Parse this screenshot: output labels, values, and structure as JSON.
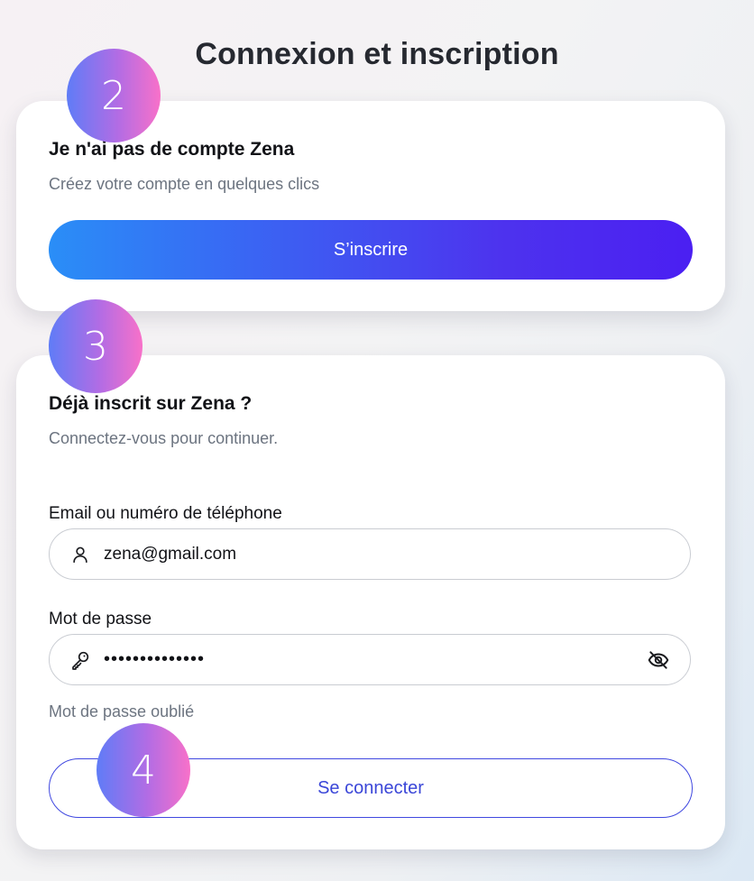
{
  "page": {
    "title": "Connexion et inscription"
  },
  "steps": {
    "signup": "2",
    "login": "3",
    "submit": "4"
  },
  "signup_card": {
    "title": "Je n'ai pas de compte Zena",
    "subtitle": "Créez votre compte en quelques clics",
    "button_label": "S’inscrire"
  },
  "login_card": {
    "title": "Déjà inscrit sur Zena ?",
    "subtitle": "Connectez-vous pour continuer.",
    "email_label": "Email ou numéro de téléphone",
    "email_value": "zena@gmail.com",
    "password_label": "Mot de passe",
    "password_value": "••••••••••••••",
    "forgot_label": "Mot de passe oublié",
    "submit_label": "Se connecter"
  },
  "icons": {
    "email_field": "user-icon",
    "password_field": "key-icon",
    "password_toggle": "eye-off-icon"
  },
  "colors": {
    "primary_gradient_start": "#2a8ef7",
    "primary_gradient_end": "#4b1ff2",
    "outline_button": "#3a46d8",
    "step_gradient_start": "#5f7cf7",
    "step_gradient_end": "#f871c9"
  }
}
